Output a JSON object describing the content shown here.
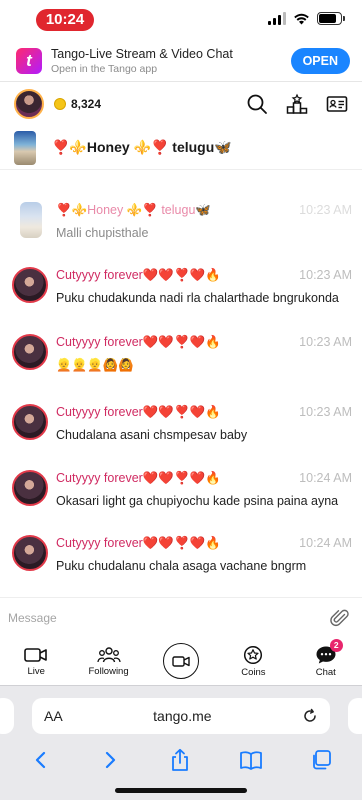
{
  "status_bar": {
    "time": "10:24"
  },
  "banner": {
    "logo_letter": "t",
    "title": "Tango-Live Stream & Video Chat",
    "subtitle": "Open in the Tango app",
    "open_label": "OPEN"
  },
  "header": {
    "coins": "8,324"
  },
  "chat": {
    "title": "❣️⚜️Honey ⚜️❣️ telugu🦋"
  },
  "messages": [
    {
      "sender": "❣️⚜️Honey ⚜️❣️ telugu🦋",
      "time": "10:23 AM",
      "text": "Malli chupisthale",
      "faded": true
    },
    {
      "sender": "Cutyyyy forever❤️❤️❣️❤️🔥",
      "time": "10:23 AM",
      "text": "Puku chudakunda nadi rla chalarthade bngrukonda"
    },
    {
      "sender": "Cutyyyy forever❤️❤️❣️❤️🔥",
      "time": "10:23 AM",
      "text": "👱👱👱🙆🙆"
    },
    {
      "sender": "Cutyyyy forever❤️❤️❣️❤️🔥",
      "time": "10:23 AM",
      "text": "Chudalana asani chsmpesav baby"
    },
    {
      "sender": "Cutyyyy forever❤️❤️❣️❤️🔥",
      "time": "10:24 AM",
      "text": "Okasari light ga chupiyochu kade psina paina ayna"
    },
    {
      "sender": "Cutyyyy forever❤️❤️❣️❤️🔥",
      "time": "10:24 AM",
      "text": "Puku chudalanu chala asaga vachane bngrm"
    }
  ],
  "input": {
    "placeholder": "Message"
  },
  "nav": {
    "live": "Live",
    "following": "Following",
    "coins": "Coins",
    "chat": "Chat",
    "chat_badge": "2"
  },
  "safari": {
    "aa": "AA",
    "url": "tango.me"
  },
  "colors": {
    "accent": "#1a85ff",
    "sender": "#d02b62",
    "badge": "#e8266d",
    "time_pill": "#e0262e"
  }
}
